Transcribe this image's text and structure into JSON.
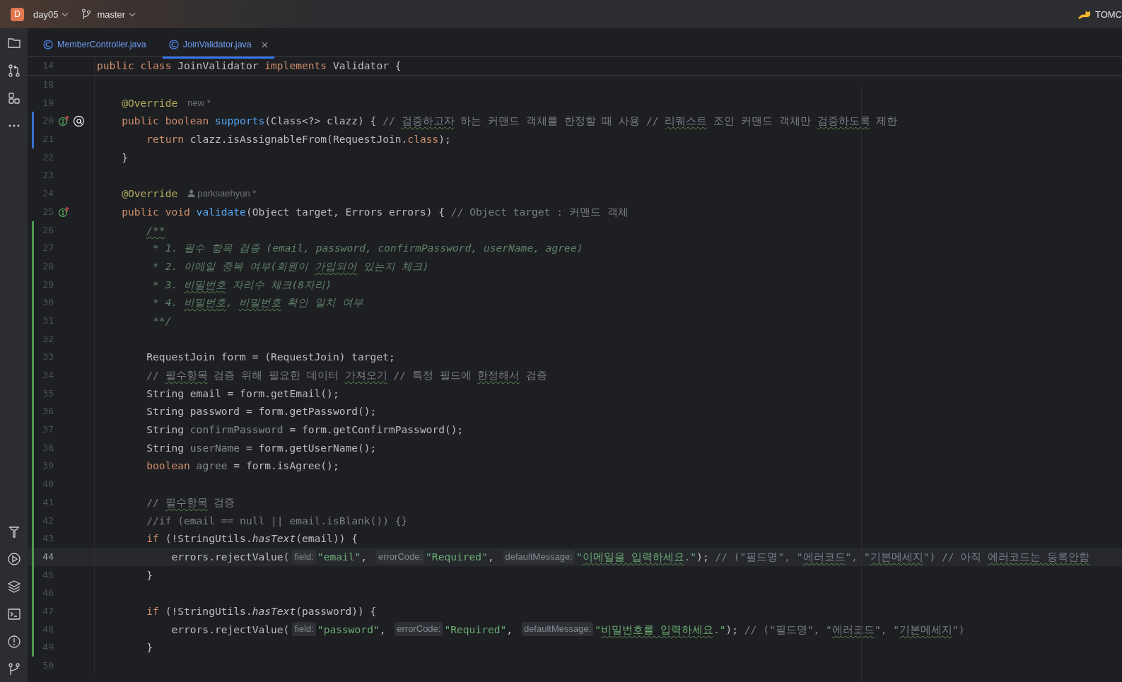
{
  "top_bar": {
    "project": {
      "badge": "D",
      "name": "day05"
    },
    "branch": "master",
    "run_config": "TOMC"
  },
  "tabs": [
    {
      "label": "MemberController.java",
      "selected": false
    },
    {
      "label": "JoinValidator.java",
      "selected": true
    }
  ],
  "editor": {
    "sticky_line": {
      "number": "14",
      "tokens": [
        {
          "kind": "kw",
          "text": "public class "
        },
        {
          "kind": "plain",
          "text": "JoinValidator "
        },
        {
          "kind": "kw",
          "text": "implements "
        },
        {
          "kind": "plain",
          "text": "Validator {"
        }
      ]
    },
    "lines": [
      {
        "number": "18",
        "modified": false,
        "added": false,
        "current": false
      },
      {
        "number": "19",
        "modified": false,
        "added": false,
        "current": false,
        "tokens": [
          {
            "kind": "ann",
            "text": "    @Override"
          },
          {
            "kind": "author",
            "text": "new *"
          }
        ]
      },
      {
        "number": "20",
        "modified": true,
        "added": false,
        "current": false,
        "gutter": [
          {
            "kind": "implements"
          },
          {
            "kind": "annotation"
          }
        ],
        "tokens": [
          {
            "kind": "kw",
            "text": "    public boolean "
          },
          {
            "kind": "method",
            "text": "supports"
          },
          {
            "kind": "plain",
            "text": "(Class<?> clazz) { "
          },
          {
            "kind": "comment",
            "text": "// "
          },
          {
            "kind": "comment_typo",
            "text": "검증하고자"
          },
          {
            "kind": "comment",
            "text": " 하는 커맨드 객체를 한정할 때 사용 // "
          },
          {
            "kind": "comment_typo",
            "text": "리퀘스트"
          },
          {
            "kind": "comment",
            "text": " 조인 커맨드 객체만 "
          },
          {
            "kind": "comment_typo",
            "text": "검증하도록"
          },
          {
            "kind": "comment",
            "text": " 제한"
          }
        ]
      },
      {
        "number": "21",
        "modified": true,
        "added": false,
        "current": false,
        "tokens": [
          {
            "kind": "kw",
            "text": "        return "
          },
          {
            "kind": "plain",
            "text": "clazz.isAssignableFrom(RequestJoin."
          },
          {
            "kind": "kw",
            "text": "class"
          },
          {
            "kind": "plain",
            "text": ");"
          }
        ]
      },
      {
        "number": "22",
        "modified": false,
        "added": false,
        "current": false,
        "tokens": [
          {
            "kind": "plain",
            "text": "    }"
          }
        ]
      },
      {
        "number": "23",
        "modified": false,
        "added": false,
        "current": false
      },
      {
        "number": "24",
        "modified": false,
        "added": false,
        "current": false,
        "tokens": [
          {
            "kind": "ann",
            "text": "    @Override"
          },
          {
            "kind": "author_user",
            "text": "parksaehyun *"
          }
        ]
      },
      {
        "number": "25",
        "modified": false,
        "added": false,
        "current": false,
        "gutter": [
          {
            "kind": "implements"
          }
        ],
        "tokens": [
          {
            "kind": "kw",
            "text": "    public void "
          },
          {
            "kind": "method",
            "text": "validate"
          },
          {
            "kind": "plain",
            "text": "(Object target, Errors errors) { "
          },
          {
            "kind": "comment",
            "text": "// Object target : 커맨드 객체"
          }
        ]
      },
      {
        "number": "26",
        "modified": false,
        "added": true,
        "current": false,
        "tokens": [
          {
            "kind": "doc_typo",
            "text": "        /**"
          }
        ]
      },
      {
        "number": "27",
        "modified": false,
        "added": true,
        "current": false,
        "tokens": [
          {
            "kind": "doc",
            "text": "         * 1. 필수 항목 검증 (email, password, confirmPassword, userName, agree)"
          }
        ]
      },
      {
        "number": "28",
        "modified": false,
        "added": true,
        "current": false,
        "tokens": [
          {
            "kind": "doc",
            "text": "         * 2. 이메일 중복 여부(회원이 "
          },
          {
            "kind": "doc_typo",
            "text": "가입되어"
          },
          {
            "kind": "doc",
            "text": " 있는지 체크)"
          }
        ]
      },
      {
        "number": "29",
        "modified": false,
        "added": true,
        "current": false,
        "tokens": [
          {
            "kind": "doc",
            "text": "         * 3. "
          },
          {
            "kind": "doc_typo",
            "text": "비밀번호"
          },
          {
            "kind": "doc",
            "text": " 자리수 체크(8자리)"
          }
        ]
      },
      {
        "number": "30",
        "modified": false,
        "added": true,
        "current": false,
        "tokens": [
          {
            "kind": "doc",
            "text": "         * 4. "
          },
          {
            "kind": "doc_typo",
            "text": "비밀번호"
          },
          {
            "kind": "doc",
            "text": ", "
          },
          {
            "kind": "doc_typo",
            "text": "비밀번호"
          },
          {
            "kind": "doc",
            "text": " 확인 일치 여부"
          }
        ]
      },
      {
        "number": "31",
        "modified": false,
        "added": true,
        "current": false,
        "tokens": [
          {
            "kind": "doc",
            "text": "         **/"
          }
        ]
      },
      {
        "number": "32",
        "modified": false,
        "added": true,
        "current": false
      },
      {
        "number": "33",
        "modified": false,
        "added": true,
        "current": false,
        "tokens": [
          {
            "kind": "plain",
            "text": "        RequestJoin form = (RequestJoin) target;"
          }
        ]
      },
      {
        "number": "34",
        "modified": false,
        "added": true,
        "current": false,
        "tokens": [
          {
            "kind": "comment",
            "text": "        // "
          },
          {
            "kind": "comment_typo",
            "text": "필수항목"
          },
          {
            "kind": "comment",
            "text": " 검증 위해 필요한 데이터 "
          },
          {
            "kind": "comment_typo",
            "text": "가져오기"
          },
          {
            "kind": "comment",
            "text": " // 특정 필드에 "
          },
          {
            "kind": "comment_typo",
            "text": "한정해서"
          },
          {
            "kind": "comment",
            "text": " 검증"
          }
        ]
      },
      {
        "number": "35",
        "modified": false,
        "added": true,
        "current": false,
        "tokens": [
          {
            "kind": "plain",
            "text": "        String email = form.getEmail();"
          }
        ]
      },
      {
        "number": "36",
        "modified": false,
        "added": true,
        "current": false,
        "tokens": [
          {
            "kind": "plain",
            "text": "        String password = form.getPassword();"
          }
        ]
      },
      {
        "number": "37",
        "modified": false,
        "added": true,
        "current": false,
        "tokens": [
          {
            "kind": "plain",
            "text": "        String "
          },
          {
            "kind": "unused",
            "text": "confirmPassword"
          },
          {
            "kind": "plain",
            "text": " = form.getConfirmPassword();"
          }
        ]
      },
      {
        "number": "38",
        "modified": false,
        "added": true,
        "current": false,
        "tokens": [
          {
            "kind": "plain",
            "text": "        String "
          },
          {
            "kind": "unused",
            "text": "userName"
          },
          {
            "kind": "plain",
            "text": " = form.getUserName();"
          }
        ]
      },
      {
        "number": "39",
        "modified": false,
        "added": true,
        "current": false,
        "tokens": [
          {
            "kind": "kw",
            "text": "        boolean "
          },
          {
            "kind": "unused",
            "text": "agree"
          },
          {
            "kind": "plain",
            "text": " = form.isAgree();"
          }
        ]
      },
      {
        "number": "40",
        "modified": false,
        "added": true,
        "current": false
      },
      {
        "number": "41",
        "modified": false,
        "added": true,
        "current": false,
        "tokens": [
          {
            "kind": "comment",
            "text": "        // "
          },
          {
            "kind": "comment_typo",
            "text": "필수항목"
          },
          {
            "kind": "comment",
            "text": " 검증"
          }
        ]
      },
      {
        "number": "42",
        "modified": false,
        "added": true,
        "current": false,
        "tokens": [
          {
            "kind": "comment",
            "text": "        //if (email == null || email.isBlank()) {}"
          }
        ]
      },
      {
        "number": "43",
        "modified": false,
        "added": true,
        "current": false,
        "tokens": [
          {
            "kind": "kw",
            "text": "        if "
          },
          {
            "kind": "plain",
            "text": "(!StringUtils."
          },
          {
            "kind": "static",
            "text": "hasText"
          },
          {
            "kind": "plain",
            "text": "(email)) {"
          }
        ]
      },
      {
        "number": "44",
        "modified": false,
        "added": true,
        "current": true,
        "tokens": [
          {
            "kind": "plain",
            "text": "            errors.rejectValue("
          },
          {
            "kind": "hint",
            "text": "field:"
          },
          {
            "kind": "string",
            "text": "\"email\""
          },
          {
            "kind": "plain",
            "text": ", "
          },
          {
            "kind": "hint",
            "text": "errorCode:"
          },
          {
            "kind": "string",
            "text": "\"Required\""
          },
          {
            "kind": "plain",
            "text": ", "
          },
          {
            "kind": "hint",
            "text": "defaultMessage:"
          },
          {
            "kind": "string",
            "text": "\""
          },
          {
            "kind": "string_typo",
            "text": "이메일을 입력하세요"
          },
          {
            "kind": "string",
            "text": ".\""
          },
          {
            "kind": "plain",
            "text": "); "
          },
          {
            "kind": "comment",
            "text": "// (\"필드명\", \""
          },
          {
            "kind": "comment_typo",
            "text": "에러코드"
          },
          {
            "kind": "comment",
            "text": "\", \""
          },
          {
            "kind": "comment_typo",
            "text": "기본메세지"
          },
          {
            "kind": "comment",
            "text": "\") // 아직 "
          },
          {
            "kind": "comment_typo",
            "text": "에러코드는 등록안함"
          }
        ]
      },
      {
        "number": "45",
        "modified": false,
        "added": true,
        "current": false,
        "tokens": [
          {
            "kind": "plain",
            "text": "        }"
          }
        ]
      },
      {
        "number": "46",
        "modified": false,
        "added": true,
        "current": false
      },
      {
        "number": "47",
        "modified": false,
        "added": true,
        "current": false,
        "tokens": [
          {
            "kind": "kw",
            "text": "        if "
          },
          {
            "kind": "plain",
            "text": "(!StringUtils."
          },
          {
            "kind": "static",
            "text": "hasText"
          },
          {
            "kind": "plain",
            "text": "(password)) {"
          }
        ]
      },
      {
        "number": "48",
        "modified": false,
        "added": true,
        "current": false,
        "tokens": [
          {
            "kind": "plain",
            "text": "            errors.rejectValue("
          },
          {
            "kind": "hint",
            "text": "field:"
          },
          {
            "kind": "string",
            "text": "\"password\""
          },
          {
            "kind": "plain",
            "text": ", "
          },
          {
            "kind": "hint",
            "text": "errorCode:"
          },
          {
            "kind": "string",
            "text": "\"Required\""
          },
          {
            "kind": "plain",
            "text": ", "
          },
          {
            "kind": "hint",
            "text": "defaultMessage:"
          },
          {
            "kind": "string",
            "text": "\""
          },
          {
            "kind": "string_typo",
            "text": "비밀번호를 입력하세요"
          },
          {
            "kind": "string",
            "text": ".\""
          },
          {
            "kind": "plain",
            "text": "); "
          },
          {
            "kind": "comment",
            "text": "// (\"필드명\", \""
          },
          {
            "kind": "comment_typo",
            "text": "에러코드"
          },
          {
            "kind": "comment",
            "text": "\", \""
          },
          {
            "kind": "comment_typo",
            "text": "기본메세지"
          },
          {
            "kind": "comment",
            "text": "\")"
          }
        ]
      },
      {
        "number": "49",
        "modified": false,
        "added": true,
        "current": false,
        "tokens": [
          {
            "kind": "plain",
            "text": "        }"
          }
        ]
      },
      {
        "number": "50",
        "modified": false,
        "added": false,
        "current": false
      }
    ]
  }
}
